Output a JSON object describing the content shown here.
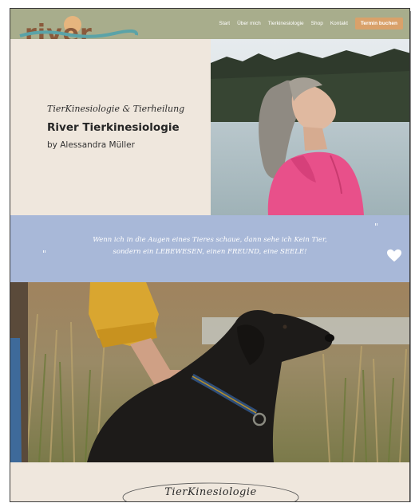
{
  "header": {
    "logo_text": "river",
    "nav": [
      "Start",
      "Über mich",
      "Tierkinesiologie",
      "Shop",
      "Kontakt"
    ],
    "cta": "Termin buchen"
  },
  "hero": {
    "subtitle": "TierKinesiologie & Tierheilung",
    "title": "River Tierkinesiologie",
    "byline": "by Alessandra Müller"
  },
  "quote": {
    "line1": "Wenn ich in die Augen eines Tieres schaue, dann sehe ich Kein Tier,",
    "line2": "sondern ein LEBEWESEN, einen FREUND, eine SEELE!",
    "open_mark": "\"",
    "close_mark": "\""
  },
  "section": {
    "title": "TierKinesiologie"
  },
  "colors": {
    "header_bg": "#a8ad8c",
    "cream": "#efe7dd",
    "quote_bg": "#a8b8d8",
    "cta_bg": "#d9a16a",
    "logo_brown": "#8a5a3c",
    "logo_teal": "#5aa3a8"
  }
}
